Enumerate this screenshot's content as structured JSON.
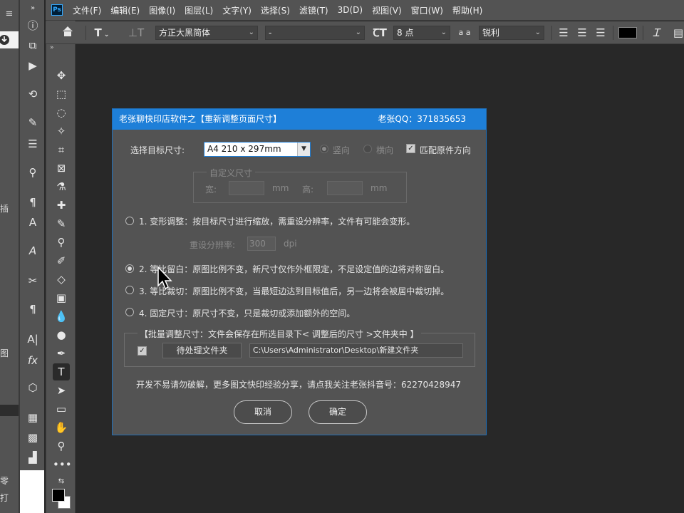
{
  "app": {
    "logo": "Ps"
  },
  "menu": [
    "文件(F)",
    "编辑(E)",
    "图像(I)",
    "图层(L)",
    "文字(Y)",
    "选择(S)",
    "滤镜(T)",
    "3D(D)",
    "视图(V)",
    "窗口(W)",
    "帮助(H)"
  ],
  "options": {
    "font_family": "方正大黑简体",
    "font_style": "-",
    "font_size": "8 点",
    "anti_alias": "锐利",
    "text_color": "#000000",
    "aa_icon_label": "a a"
  },
  "left_strip": {
    "chars": [
      "插",
      "图",
      "零",
      "打"
    ]
  },
  "dialog": {
    "title": "老张聊快印店软件之【重新调整页面尺寸】",
    "qq": "老张QQ：371835653",
    "target_label": "选择目标尺寸:",
    "target_value": "A4  210 x 297mm",
    "portrait": "竖向",
    "landscape": "横向",
    "match_orientation": "匹配原件方向",
    "custom_size_title": "自定义尺寸",
    "width_label": "宽:",
    "height_label": "高:",
    "unit_mm": "mm",
    "option1": "1. 变形调整：按目标尺寸进行缩放，需重设分辨率，文件有可能会变形。",
    "resample_label": "重设分辨率:",
    "resample_value": "300",
    "unit_dpi": "dpi",
    "option2": "2. 等比留白：原图比例不变，新尺寸仅作外框限定，不足设定值的边将对称留白。",
    "option3": "3. 等比裁切：原图比例不变，当最短边达到目标值后，另一边将会被居中裁切掉。",
    "option4": "4. 固定尺寸：原尺寸不变，只是裁切或添加额外的空间。",
    "batch_title": "【批量调整尺寸：文件会保存在所选目录下< 调整后的尺寸 >文件夹中 】",
    "pending_button": "待处理文件夹",
    "path_value": "C:\\Users\\Administrator\\Desktop\\新建文件夹",
    "footer_note": "开发不易请勿破解，更多图文快印经验分享，请点我关注老张抖音号：62270428947",
    "cancel": "取消",
    "ok": "确定",
    "selected_option": 2,
    "title_color": "#1e7fd8"
  },
  "icons": {
    "home": "home-icon",
    "text_tool": "type-tool-icon",
    "vertical_text": "vertical-type-icon",
    "font_size_icon": "font-size-icon",
    "align_left": "align-left-icon",
    "align_center": "align-center-icon",
    "align_right": "align-right-icon",
    "warp": "warp-text-icon"
  }
}
